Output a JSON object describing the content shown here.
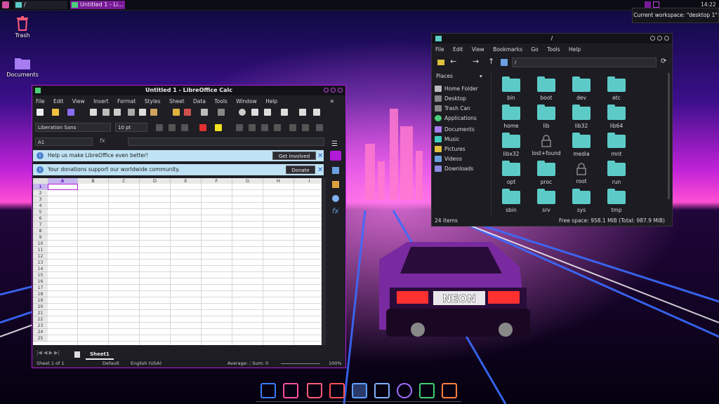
{
  "topbar": {
    "entry1_label": "/",
    "entry2_label": "Untitled 1 - Li...",
    "clock": "14:22"
  },
  "tooltip": "Current workspace: \"desktop 1\"",
  "desktop_icons": [
    {
      "label": "Trash"
    },
    {
      "label": "Documents"
    }
  ],
  "calc": {
    "title": "Untitled 1 - LibreOffice Calc",
    "menu": [
      "File",
      "Edit",
      "View",
      "Insert",
      "Format",
      "Styles",
      "Sheet",
      "Data",
      "Tools",
      "Window",
      "Help"
    ],
    "font_name": "Liberation Sans",
    "font_size": "10 pt",
    "cell_ref": "A1",
    "fx_label": "fx",
    "infobar1_text": "Help us make LibreOffice even better!",
    "infobar1_button": "Get involved",
    "infobar2_text": "Your donations support our worldwide community.",
    "infobar2_button": "Donate",
    "columns": [
      "A",
      "B",
      "C",
      "D",
      "E",
      "F",
      "G",
      "H",
      "I"
    ],
    "rows": [
      "1",
      "2",
      "3",
      "4",
      "5",
      "6",
      "7",
      "8",
      "9",
      "10",
      "11",
      "12",
      "13",
      "14",
      "15",
      "16",
      "17",
      "18",
      "19",
      "20",
      "21",
      "22",
      "23",
      "24",
      "25"
    ],
    "sheet_tab": "Sheet1",
    "status": {
      "sheet": "Sheet 1 of 1",
      "style": "Default",
      "language": "English (USA)",
      "sum": "Average: ; Sum: 0",
      "zoom": "100%"
    }
  },
  "filemanager": {
    "title": "/",
    "menu": [
      "File",
      "Edit",
      "View",
      "Bookmarks",
      "Go",
      "Tools",
      "Help"
    ],
    "path": "/",
    "places_header": "Places",
    "places": [
      "Home Folder",
      "Desktop",
      "Trash Can",
      "Applications",
      "Documents",
      "Music",
      "Pictures",
      "Videos",
      "Downloads"
    ],
    "items": [
      "bin",
      "boot",
      "dev",
      "etc",
      "home",
      "lib",
      "lib32",
      "lib64",
      "libx32",
      "lost+found",
      "media",
      "mnt",
      "opt",
      "proc",
      "root",
      "run",
      "sbin",
      "srv",
      "sys",
      "tmp"
    ],
    "item_count": "24 items",
    "free_space": "Free space: 958.1 MiB (Total: 987.9 MiB)"
  },
  "wallpaper": {
    "plate_text": "NEON"
  },
  "colors": {
    "accent": "#b21bd6",
    "folder": "#5ccbc8",
    "infobar": "#bfe3f4"
  }
}
